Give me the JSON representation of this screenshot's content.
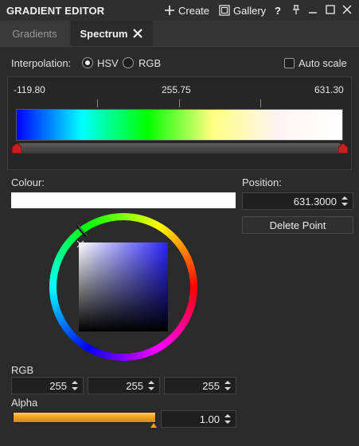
{
  "window": {
    "title": "GRADIENT EDITOR",
    "create_label": "Create",
    "gallery_label": "Gallery",
    "help_label": "?"
  },
  "tabs": [
    {
      "label": "Gradients",
      "active": false
    },
    {
      "label": "Spectrum",
      "active": true
    }
  ],
  "interpolation": {
    "label": "Interpolation:",
    "options": [
      "HSV",
      "RGB"
    ],
    "selected": "HSV",
    "auto_scale_label": "Auto scale",
    "auto_scale_checked": false
  },
  "ruler": {
    "min": "-119.80",
    "mid": "255.75",
    "max": "631.30"
  },
  "gradient": {
    "stops": [
      "#0000ff",
      "#00ffff",
      "#00ff00",
      "#ffff80",
      "#fff4f4",
      "#ffffff"
    ]
  },
  "colour": {
    "label": "Colour:",
    "value_hex": "#ffffff"
  },
  "position": {
    "label": "Position:",
    "value": "631.3000",
    "delete_label": "Delete Point"
  },
  "rgb": {
    "label": "RGB",
    "r": "255",
    "g": "255",
    "b": "255"
  },
  "alpha": {
    "label": "Alpha",
    "value": "1.00",
    "level": 1.0
  }
}
